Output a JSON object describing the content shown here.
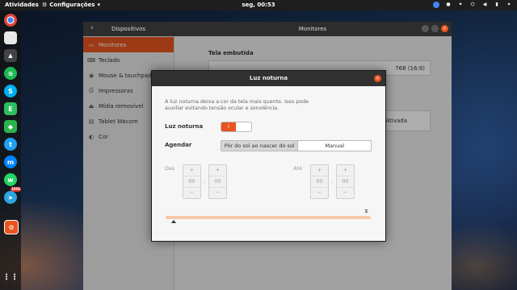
{
  "topbar": {
    "activities": "Atividades",
    "app_menu": "Configurações",
    "clock": "seg, 00:53"
  },
  "settings": {
    "sidebar_title": "Dispositivos",
    "main_title": "Monitores",
    "sidebar_items": [
      {
        "label": "Monitores",
        "icon": "monitor-icon"
      },
      {
        "label": "Teclado",
        "icon": "keyboard-icon"
      },
      {
        "label": "Mouse & touchpad",
        "icon": "mouse-icon"
      },
      {
        "label": "Impressoras",
        "icon": "printer-icon"
      },
      {
        "label": "Mídia removível",
        "icon": "removable-media-icon"
      },
      {
        "label": "Tablet Wacom",
        "icon": "tablet-icon"
      },
      {
        "label": "Cor",
        "icon": "color-icon"
      }
    ],
    "display_section": "Tela embutida",
    "resolution_partial": "768 (16:9)",
    "night_light_value": "Ativada"
  },
  "dialog": {
    "title": "Luz noturna",
    "description": "A luz noturna deixa a cor da tela mais quente. Isso pode auxiliar evitando tensão ocular e sonolência.",
    "toggle_label": "Luz noturna",
    "toggle_state": "I",
    "schedule_label": "Agendar",
    "schedule_options": [
      "Pôr do sol ao nascer do sol",
      "Manual"
    ],
    "from_label": "Das",
    "to_label": "Até",
    "from_hours": "00",
    "from_minutes": "00",
    "to_hours": "00",
    "to_minutes": "00",
    "plus": "+",
    "minus": "−",
    "colon": ":"
  },
  "colors": {
    "accent": "#e95420",
    "titlebar": "#2d2d2d"
  }
}
